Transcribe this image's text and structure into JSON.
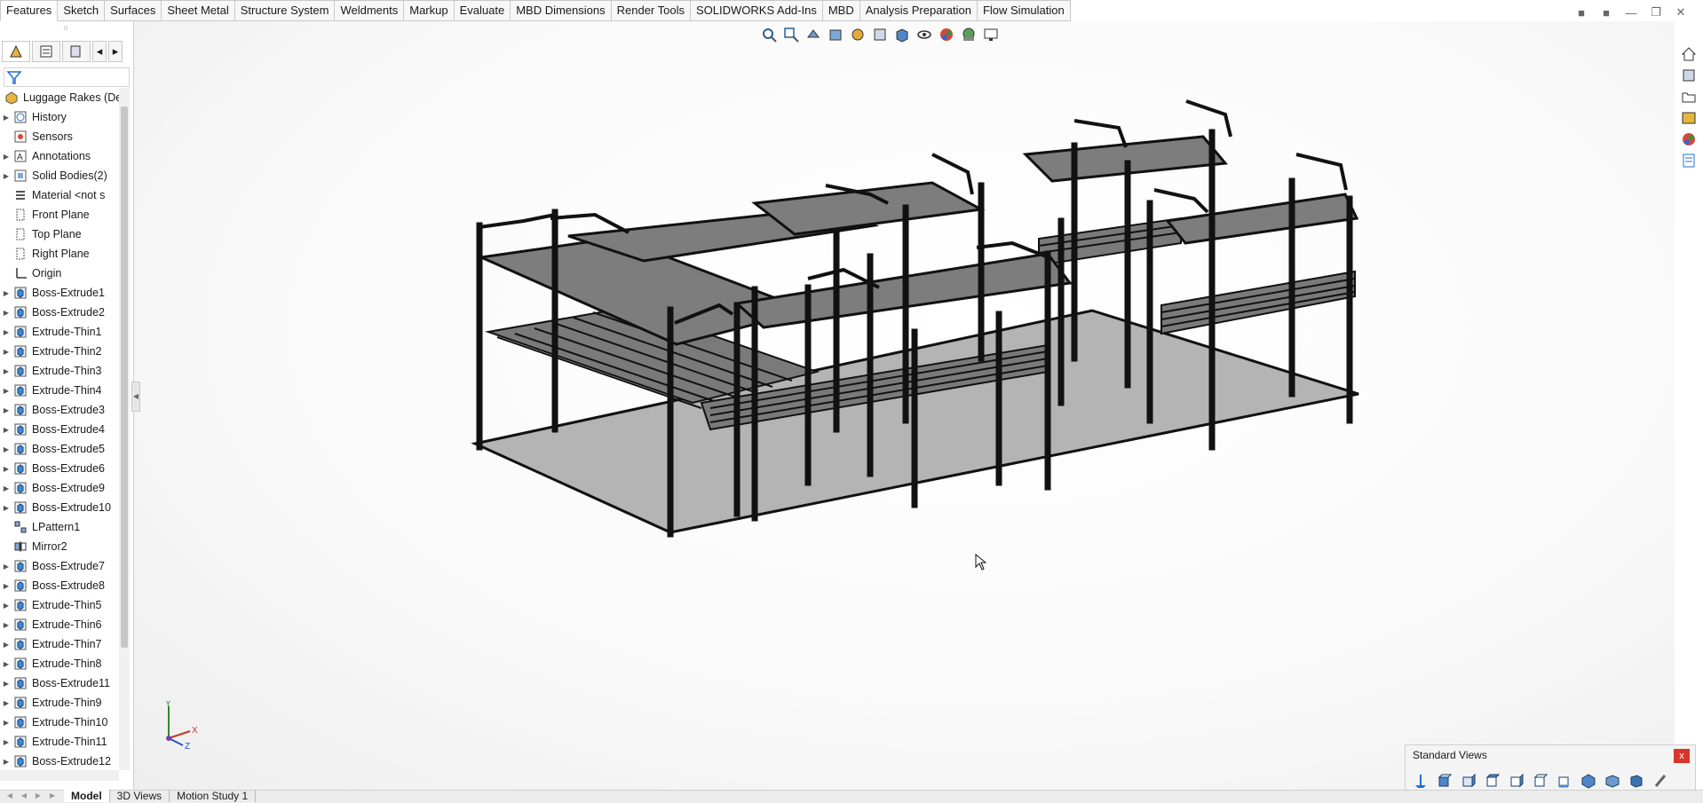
{
  "command_tabs": [
    "Features",
    "Sketch",
    "Surfaces",
    "Sheet Metal",
    "Structure System",
    "Weldments",
    "Markup",
    "Evaluate",
    "MBD Dimensions",
    "Render Tools",
    "SOLIDWORKS Add-Ins",
    "MBD",
    "Analysis Preparation",
    "Flow Simulation"
  ],
  "tree": {
    "root": "Luggage Rakes (Def",
    "items": [
      {
        "label": "History",
        "icon": "history-icon",
        "expand": true
      },
      {
        "label": "Sensors",
        "icon": "sensors-icon",
        "expand": false
      },
      {
        "label": "Annotations",
        "icon": "annotations-icon",
        "expand": true
      },
      {
        "label": "Solid Bodies(2)",
        "icon": "solid-bodies-icon",
        "expand": true
      },
      {
        "label": "Material <not s",
        "icon": "material-icon",
        "expand": false
      },
      {
        "label": "Front Plane",
        "icon": "plane-icon",
        "expand": false
      },
      {
        "label": "Top Plane",
        "icon": "plane-icon",
        "expand": false
      },
      {
        "label": "Right Plane",
        "icon": "plane-icon",
        "expand": false
      },
      {
        "label": "Origin",
        "icon": "origin-icon",
        "expand": false
      },
      {
        "label": "Boss-Extrude1",
        "icon": "feature-icon",
        "expand": true
      },
      {
        "label": "Boss-Extrude2",
        "icon": "feature-icon",
        "expand": true
      },
      {
        "label": "Extrude-Thin1",
        "icon": "feature-icon",
        "expand": true
      },
      {
        "label": "Extrude-Thin2",
        "icon": "feature-icon",
        "expand": true
      },
      {
        "label": "Extrude-Thin3",
        "icon": "feature-icon",
        "expand": true
      },
      {
        "label": "Extrude-Thin4",
        "icon": "feature-icon",
        "expand": true
      },
      {
        "label": "Boss-Extrude3",
        "icon": "feature-icon",
        "expand": true
      },
      {
        "label": "Boss-Extrude4",
        "icon": "feature-icon",
        "expand": true
      },
      {
        "label": "Boss-Extrude5",
        "icon": "feature-icon",
        "expand": true
      },
      {
        "label": "Boss-Extrude6",
        "icon": "feature-icon",
        "expand": true
      },
      {
        "label": "Boss-Extrude9",
        "icon": "feature-icon",
        "expand": true
      },
      {
        "label": "Boss-Extrude10",
        "icon": "feature-icon",
        "expand": true
      },
      {
        "label": "LPattern1",
        "icon": "pattern-icon",
        "expand": false
      },
      {
        "label": "Mirror2",
        "icon": "mirror-icon",
        "expand": false
      },
      {
        "label": "Boss-Extrude7",
        "icon": "feature-icon",
        "expand": true
      },
      {
        "label": "Boss-Extrude8",
        "icon": "feature-icon",
        "expand": true
      },
      {
        "label": "Extrude-Thin5",
        "icon": "feature-icon",
        "expand": true
      },
      {
        "label": "Extrude-Thin6",
        "icon": "feature-icon",
        "expand": true
      },
      {
        "label": "Extrude-Thin7",
        "icon": "feature-icon",
        "expand": true
      },
      {
        "label": "Extrude-Thin8",
        "icon": "feature-icon",
        "expand": true
      },
      {
        "label": "Boss-Extrude11",
        "icon": "feature-icon",
        "expand": true
      },
      {
        "label": "Extrude-Thin9",
        "icon": "feature-icon",
        "expand": true
      },
      {
        "label": "Extrude-Thin10",
        "icon": "feature-icon",
        "expand": true
      },
      {
        "label": "Extrude-Thin11",
        "icon": "feature-icon",
        "expand": true
      },
      {
        "label": "Boss-Extrude12",
        "icon": "feature-icon",
        "expand": true
      }
    ]
  },
  "standard_views": {
    "title": "Standard Views",
    "close": "x"
  },
  "bottom_tabs": [
    "Model",
    "3D Views",
    "Motion Study 1"
  ],
  "triad": {
    "x": "X",
    "y": "Y",
    "z": "Z"
  },
  "colors": {
    "accent": "#1f6fd1",
    "tab_bg": "#f7f7f7",
    "model_face": "#8c8c8c",
    "floor": "#b5b5b5"
  }
}
